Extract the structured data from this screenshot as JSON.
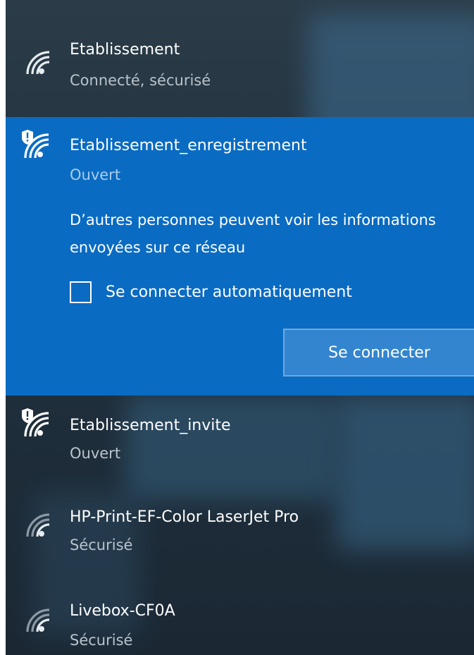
{
  "networks": [
    {
      "ssid": "Etablissement",
      "status": "Connecté, sécurisé",
      "icon": "wifi-secured-icon"
    },
    {
      "ssid": "Etablissement_enregistrement",
      "status": "Ouvert",
      "icon": "wifi-open-warning-icon",
      "warning": "D’autres personnes peuvent voir les informations envoyées sur ce réseau",
      "auto_connect_label": "Se connecter automatiquement",
      "auto_connect_checked": false,
      "connect_label": "Se connecter"
    },
    {
      "ssid": "Etablissement_invite",
      "status": "Ouvert",
      "icon": "wifi-open-warning-icon"
    },
    {
      "ssid": "HP-Print-EF-Color LaserJet Pro",
      "status": "Sécurisé",
      "icon": "wifi-secured-icon"
    },
    {
      "ssid": "Livebox-CF0A",
      "status": "Sécurisé",
      "icon": "wifi-secured-icon"
    }
  ],
  "colors": {
    "selected_background": "#0a6bc2",
    "flyout_background": "#22323f",
    "secondary_text": "#b9c3cc",
    "button_background": "#3385cf"
  }
}
